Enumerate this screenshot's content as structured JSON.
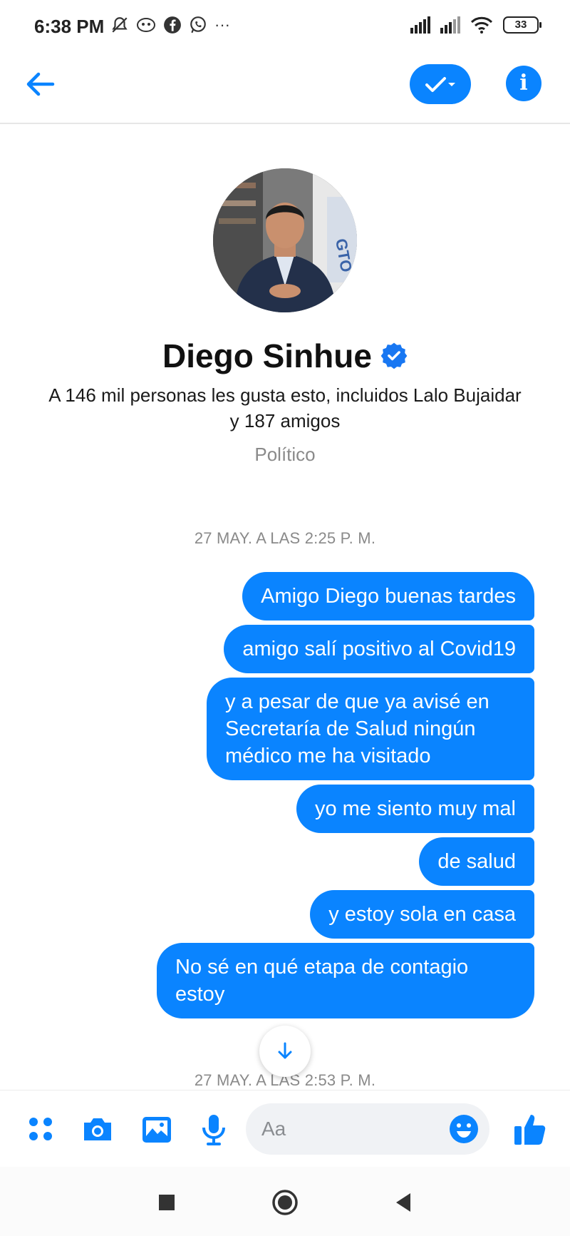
{
  "status_bar": {
    "time": "6:38 PM",
    "more": "···",
    "battery": "33",
    "icons": [
      "silent-icon",
      "emoji-icon",
      "facebook-icon",
      "whatsapp-icon",
      "signal-icon",
      "signal-icon",
      "wifi-icon",
      "battery-icon"
    ]
  },
  "header": {
    "icons": [
      "back-arrow-icon",
      "check-icon",
      "info-icon"
    ],
    "info_glyph": "i"
  },
  "profile": {
    "name": "Diego Sinhue",
    "likes": "A 146 mil personas les gusta esto, incluidos Lalo Bujaidar y 187 amigos",
    "category": "Político",
    "sign_text": "GTO"
  },
  "conversation": {
    "timestamp_1": "27 MAY. A LAS 2:25 P. M.",
    "timestamp_2": "27 MAY. A LAS 2:53 P. M.",
    "messages": [
      "Amigo Diego buenas tardes",
      "amigo salí positivo al Covid19",
      "y a pesar de que ya avisé en Secretaría de Salud ningún médico me ha visitado",
      "yo me siento muy mal",
      "de salud",
      "y estoy sola en casa",
      "No sé en qué etapa de contagio estoy"
    ]
  },
  "composer": {
    "placeholder": "Aa",
    "icons": [
      "apps-icon",
      "camera-icon",
      "image-icon",
      "microphone-icon",
      "emoji-icon",
      "thumbs-up-icon"
    ]
  },
  "colors": {
    "accent": "#0a84ff",
    "bubble_text": "#ffffff",
    "muted_text": "#8a8a8a"
  }
}
